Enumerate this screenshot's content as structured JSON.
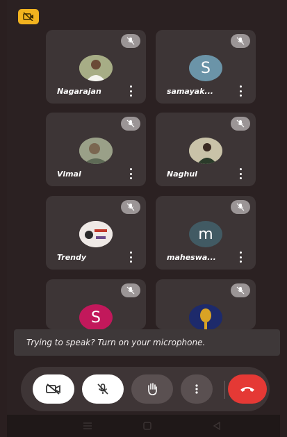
{
  "participants": [
    {
      "name": "Nagarajan",
      "avatar_type": "photo",
      "avatar_color": "#9aa07a",
      "muted": true
    },
    {
      "name": "samayak...",
      "avatar_type": "letter",
      "initial": "S",
      "avatar_color": "#6b94a8",
      "muted": true
    },
    {
      "name": "Vimal",
      "avatar_type": "photo",
      "avatar_color": "#8a9078",
      "muted": true
    },
    {
      "name": "Naghul",
      "avatar_type": "photo",
      "avatar_color": "#6f7a62",
      "muted": true
    },
    {
      "name": "Trendy",
      "avatar_type": "logo",
      "avatar_color": "#e8e2e0",
      "muted": true
    },
    {
      "name": "maheswa...",
      "avatar_type": "letter",
      "initial": "m",
      "avatar_color": "#415a63",
      "muted": true
    },
    {
      "name": "",
      "avatar_type": "letter",
      "initial": "S",
      "avatar_color": "#c2185b",
      "muted": true
    },
    {
      "name": "",
      "avatar_type": "photo",
      "avatar_color": "#1d2a6b",
      "muted": true
    }
  ],
  "toast": {
    "text": "Trying to speak? Turn on your microphone."
  },
  "controls": {
    "camera": "camera-off-icon",
    "mic": "mic-off-icon",
    "raise_hand": "hand-icon",
    "more": "more-vert-icon",
    "end_call": "end-call-icon",
    "end_call_color": "#e53935"
  },
  "accent": "#f2b31f"
}
